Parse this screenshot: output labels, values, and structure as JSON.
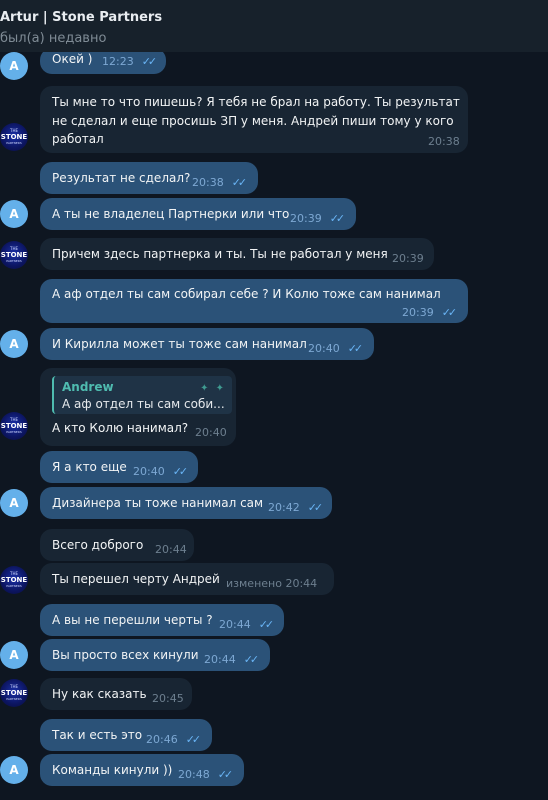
{
  "header": {
    "title": "Artur | Stone Partners",
    "status": "был(а) недавно"
  },
  "avatars": {
    "a_letter": "A",
    "logo_line1": "THE",
    "logo_line2": "STONE",
    "logo_line3": "PARTNERS"
  },
  "messages": [
    {
      "side": "out",
      "text": "Окей )",
      "time": "12:23",
      "read": true
    },
    {
      "side": "in",
      "lines": [
        "Ты мне то что пишешь? Я тебя не брал на работу. Ты результат",
        "не сделал и еще просишь ЗП у меня. Андрей пиши тому у кого",
        "работал"
      ],
      "time": "20:38"
    },
    {
      "side": "out",
      "text": "Результат не сделал?",
      "time": "20:38",
      "read": true
    },
    {
      "side": "out",
      "text": "А ты не владелец Партнерки или что",
      "time": "20:39",
      "read": true
    },
    {
      "side": "in",
      "text": "Причем здесь партнерка  и ты. Ты не работал у меня",
      "time": "20:39"
    },
    {
      "side": "out",
      "text": "А аф отдел ты сам собирал себе ? И Колю тоже сам нанимал",
      "time": "20:39",
      "read": true
    },
    {
      "side": "out",
      "text": "И Кирилла может ты тоже сам нанимал",
      "time": "20:40",
      "read": true
    },
    {
      "side": "in",
      "reply_name": "Andrew",
      "reply_text": "А аф отдел ты сам соби...",
      "text": "А кто Колю нанимал?",
      "time": "20:40"
    },
    {
      "side": "out",
      "text": "Я а кто еще",
      "time": "20:40",
      "read": true
    },
    {
      "side": "out",
      "text": "Дизайнера ты тоже нанимал сам",
      "time": "20:42",
      "read": true
    },
    {
      "side": "in",
      "text": "Всего доброго",
      "time": "20:44"
    },
    {
      "side": "in",
      "text": "Ты перешел черту Андрей",
      "edited": "изменено",
      "time": "20:44"
    },
    {
      "side": "out",
      "text": "А вы не перешли черты ?",
      "time": "20:44",
      "read": true
    },
    {
      "side": "out",
      "text": "Вы просто всех кинули",
      "time": "20:44",
      "read": true
    },
    {
      "side": "in",
      "text": "Ну как сказать",
      "time": "20:45"
    },
    {
      "side": "out",
      "text": "Так и есть это",
      "time": "20:46",
      "read": true
    },
    {
      "side": "out",
      "text": "Команды кинули ))",
      "time": "20:48",
      "read": true
    }
  ],
  "colors": {
    "background": "#0e1621",
    "incoming_bubble": "#182533",
    "outgoing_bubble": "#2b5278",
    "read_ticks": "#69b4f5",
    "reply_accent": "#4fbcb0",
    "avatar_a": "#64b0ea"
  },
  "icons": {
    "read_receipt": "double-check-icon"
  }
}
